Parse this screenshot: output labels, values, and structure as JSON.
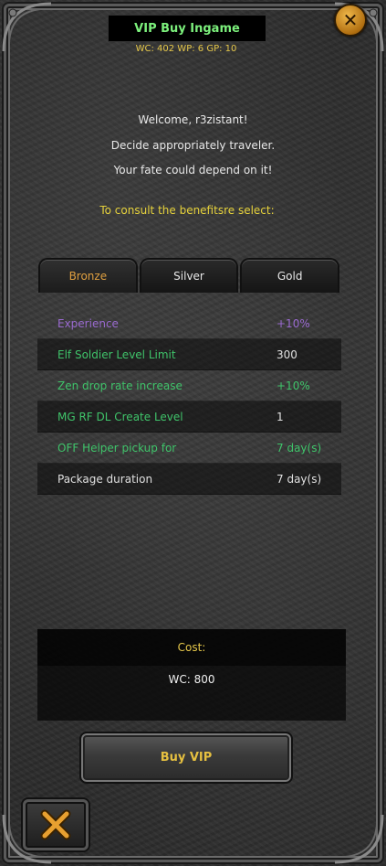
{
  "window": {
    "title": "VIP Buy Ingame",
    "currency_line": "WC: 402 WP: 6 GP: 10"
  },
  "messages": {
    "welcome": "Welcome, r3zistant!",
    "line2": "Decide appropriately traveler.",
    "line3": "Your fate could depend on it!",
    "consult": "To consult the benefitsre select:"
  },
  "tabs": [
    {
      "label": "Bronze",
      "active": true
    },
    {
      "label": "Silver",
      "active": false
    },
    {
      "label": "Gold",
      "active": false
    }
  ],
  "benefits": [
    {
      "label": "Experience",
      "value": "+10%",
      "color": "#9a6ad0"
    },
    {
      "label": "Elf Soldier Level Limit",
      "value": "300",
      "color": "#3fc46a"
    },
    {
      "label": "Zen drop rate increase",
      "value": "+10%",
      "color": "#3fc46a"
    },
    {
      "label": "MG RF DL Create Level",
      "value": "1",
      "color": "#3fc46a"
    },
    {
      "label": "OFF Helper pickup for",
      "value": "7 day(s)",
      "color": "#3fc46a"
    },
    {
      "label": "Package duration",
      "value": "7 day(s)",
      "color": "#e0e0e0"
    }
  ],
  "cost": {
    "label": "Cost:",
    "value": "WC: 800"
  },
  "buttons": {
    "buy": "Buy VIP"
  },
  "icons": {
    "close_top": "close-x-icon",
    "close_bottom": "close-x-icon"
  }
}
